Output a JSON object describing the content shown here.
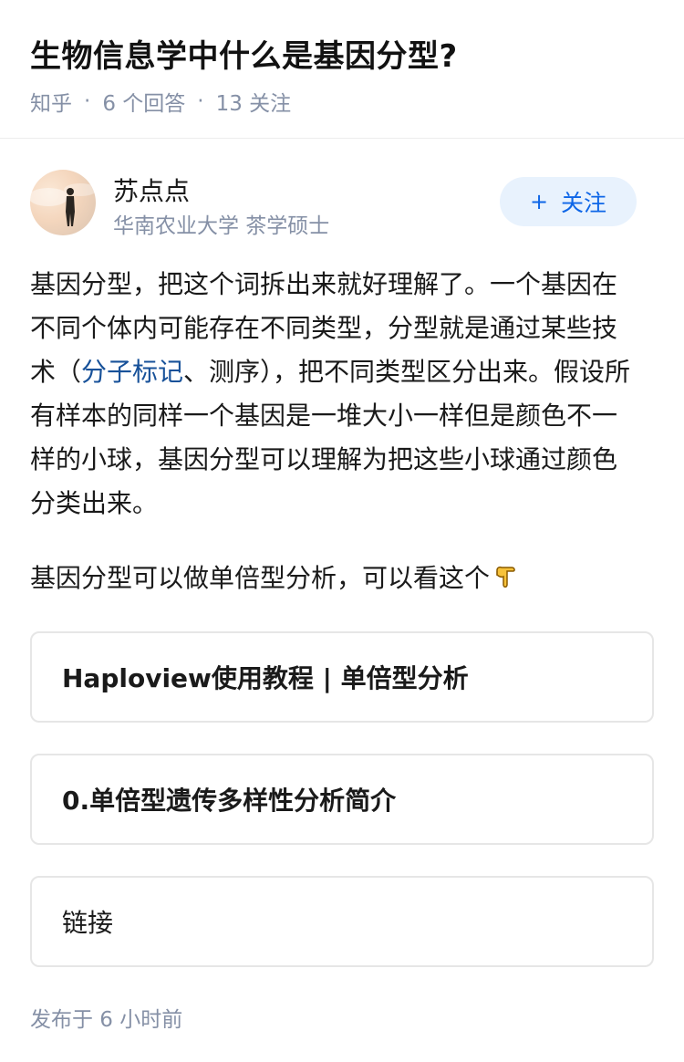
{
  "question": {
    "title": "生物信息学中什么是基因分型?",
    "source": "知乎",
    "answers": "6 个回答",
    "followers": "13 关注"
  },
  "author": {
    "name": "苏点点",
    "description": "华南农业大学 茶学硕士",
    "follow_label": "关注",
    "follow_icon": "plus-icon"
  },
  "answer": {
    "para1_a": "基因分型，把这个词拆出来就好理解了。一个基因在不同个体内可能存在不同类型，分型就是通过某些技术（",
    "para1_link": "分子标记",
    "para1_b": "、测序），把不同类型区分出来。假设所有样本的同样一个基因是一堆大小一样但是颜色不一样的小球，基因分型可以理解为把这些小球通过颜色分类出来。",
    "para2": "基因分型可以做单倍型分析，可以看这个",
    "para2_icon": "pointing-down-finger-emoji"
  },
  "link_cards": [
    {
      "label": "Haploview使用教程 | 单倍型分析"
    },
    {
      "label": "0.单倍型遗传多样性分析简介"
    },
    {
      "label": "链接"
    }
  ],
  "publish": {
    "time": "发布于  6 小时前"
  },
  "colors": {
    "accent": "#0e66e7",
    "link": "#175199",
    "meta": "#8590a6",
    "follow_bg": "#e8f2fd"
  }
}
